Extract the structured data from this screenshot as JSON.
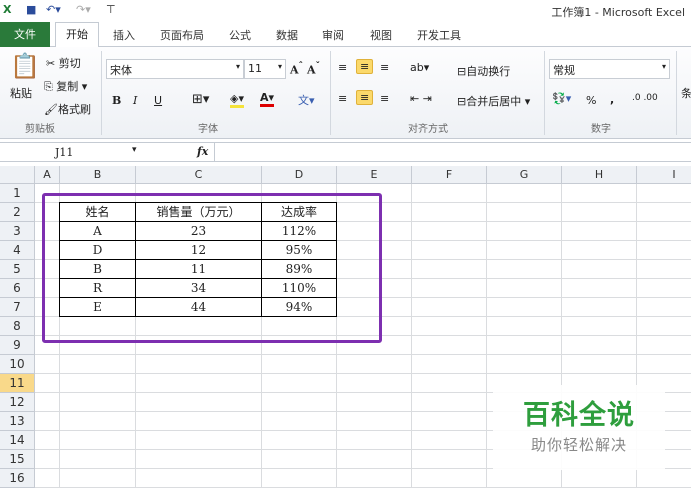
{
  "window": {
    "title": "工作簿1 - Microsoft Excel"
  },
  "tabs": [
    "文件",
    "开始",
    "插入",
    "页面布局",
    "公式",
    "数据",
    "审阅",
    "视图",
    "开发工具"
  ],
  "ribbon": {
    "clipboard": {
      "paste": "粘贴",
      "cut": "剪切",
      "copy": "复制",
      "format_painter": "格式刷",
      "group": "剪贴板"
    },
    "font": {
      "name": "宋体",
      "size": "11",
      "bold": "B",
      "italic": "I",
      "underline": "U",
      "group": "字体"
    },
    "alignment": {
      "wrap": "自动换行",
      "merge": "合并后居中",
      "group": "对齐方式"
    },
    "number": {
      "format": "常规",
      "percent": "%",
      "comma": ",",
      "group": "数字"
    },
    "styles_partial": "条"
  },
  "formula_bar": {
    "name_box": "J11",
    "fx": "fx",
    "value": ""
  },
  "columns": [
    "A",
    "B",
    "C",
    "D",
    "E",
    "F",
    "G",
    "H",
    "I"
  ],
  "rows": [
    "1",
    "2",
    "3",
    "4",
    "5",
    "6",
    "7",
    "8",
    "9",
    "10",
    "11",
    "12",
    "13",
    "14",
    "15",
    "16"
  ],
  "selected_row": "11",
  "table": {
    "headers": [
      "姓名",
      "销售量（万元）",
      "达成率"
    ],
    "rows": [
      [
        "A",
        "23",
        "112%"
      ],
      [
        "D",
        "12",
        "95%"
      ],
      [
        "B",
        "11",
        "89%"
      ],
      [
        "R",
        "34",
        "110%"
      ],
      [
        "E",
        "44",
        "94%"
      ]
    ]
  },
  "watermark": {
    "title": "百科全说",
    "subtitle": "助你轻松解决"
  }
}
